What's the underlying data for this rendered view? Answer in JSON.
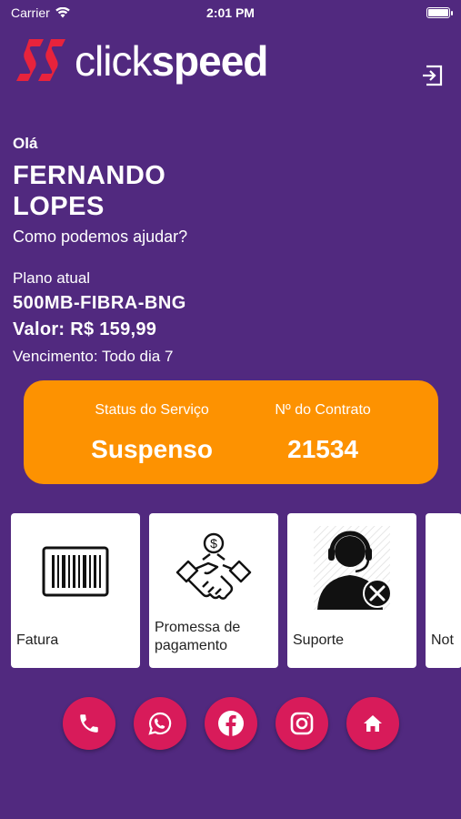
{
  "status_bar": {
    "carrier": "Carrier",
    "time": "2:01 PM"
  },
  "brand": {
    "name_light": "click",
    "name_bold": "speed",
    "accent": "#e8233c"
  },
  "greeting": {
    "hello": "Olá",
    "first_name": "FERNANDO",
    "last_name": "LOPES",
    "prompt": "Como podemos ajudar?"
  },
  "plan": {
    "label": "Plano atual",
    "name": "500MB-FIBRA-BNG",
    "value": "Valor: R$ 159,99",
    "due": "Vencimento: Todo dia 7"
  },
  "service": {
    "status_label": "Status do Serviço",
    "status_value": "Suspenso",
    "contract_label": "Nº do Contrato",
    "contract_value": "21534",
    "color": "#fd9201"
  },
  "tiles": [
    {
      "label": "Fatura",
      "icon": "barcode-icon"
    },
    {
      "label": "Promessa de pagamento",
      "icon": "handshake-money-icon"
    },
    {
      "label": "Suporte",
      "icon": "support-agent-icon"
    },
    {
      "label": "Not",
      "icon": "notification-icon"
    }
  ],
  "socials": [
    {
      "icon": "phone-icon"
    },
    {
      "icon": "whatsapp-icon"
    },
    {
      "icon": "facebook-icon"
    },
    {
      "icon": "instagram-icon"
    },
    {
      "icon": "home-icon"
    }
  ],
  "colors": {
    "background": "#51297f",
    "social": "#d81b5a"
  }
}
